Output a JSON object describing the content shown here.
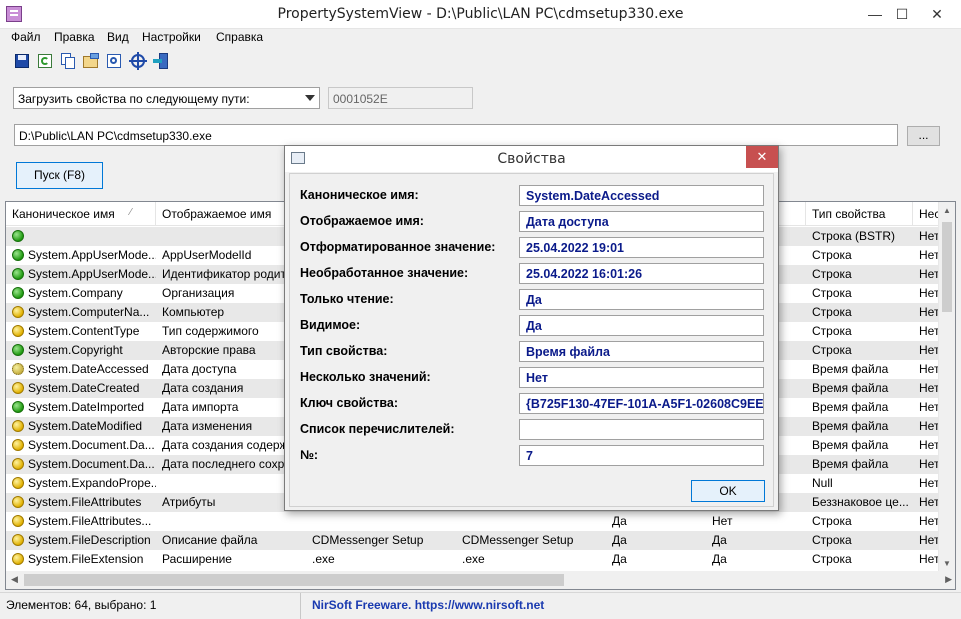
{
  "window": {
    "title": "PropertySystemView  -  D:\\Public\\LAN PC\\cdmsetup330.exe",
    "minimize": "—",
    "maximize": "☐",
    "close": "✕"
  },
  "menu": [
    "Файл",
    "Правка",
    "Вид",
    "Настройки",
    "Справка"
  ],
  "toolbar": {
    "icons": [
      "save-icon",
      "refresh-icon",
      "copy-icon",
      "properties-icon",
      "find-icon",
      "target-icon",
      "exit-icon"
    ]
  },
  "controls": {
    "load_mode": "Загрузить свойства по следующему пути:",
    "code_field": "0001052E",
    "path_field": "D:\\Public\\LAN PC\\cdmsetup330.exe",
    "browse_label": "...",
    "run_label": "Пуск (F8)"
  },
  "table": {
    "columns": [
      "Каноническое имя",
      "Отображаемое имя",
      "",
      "",
      "",
      "",
      "Тип свойства",
      "Нес"
    ],
    "rows": [
      {
        "status": "g",
        "c1": "",
        "c2": "",
        "c3": "",
        "c4": "",
        "c5": "",
        "c6": "",
        "type": "Строка (BSTR)",
        "c8": "Нет"
      },
      {
        "status": "g",
        "c1": "System.AppUserMode...",
        "c2": "AppUserModelId",
        "c3": "",
        "c4": "",
        "c5": "",
        "c6": "",
        "type": "Строка",
        "c8": "Нет"
      },
      {
        "status": "g",
        "c1": "System.AppUserMode...",
        "c2": "Идентификатор родит",
        "c3": "",
        "c4": "",
        "c5": "",
        "c6": "",
        "type": "Строка",
        "c8": "Нет"
      },
      {
        "status": "g",
        "c1": "System.Company",
        "c2": "Организация",
        "c3": "",
        "c4": "",
        "c5": "",
        "c6": "",
        "type": "Строка",
        "c8": "Нет"
      },
      {
        "status": "y",
        "c1": "System.ComputerNa...",
        "c2": "Компьютер",
        "c3": "",
        "c4": "",
        "c5": "",
        "c6": "",
        "type": "Строка",
        "c8": "Нет"
      },
      {
        "status": "y",
        "c1": "System.ContentType",
        "c2": "Тип содержимого",
        "c3": "",
        "c4": "",
        "c5": "",
        "c6": "",
        "type": "Строка",
        "c8": "Нет"
      },
      {
        "status": "g",
        "c1": "System.Copyright",
        "c2": "Авторские права",
        "c3": "",
        "c4": "",
        "c5": "",
        "c6": "",
        "type": "Строка",
        "c8": "Нет"
      },
      {
        "status": "gy",
        "c1": "System.DateAccessed",
        "c2": "Дата доступа",
        "c3": "",
        "c4": "",
        "c5": "",
        "c6": "",
        "type": "Время файла",
        "c8": "Нет"
      },
      {
        "status": "y",
        "c1": "System.DateCreated",
        "c2": "Дата создания",
        "c3": "",
        "c4": "",
        "c5": "",
        "c6": "",
        "type": "Время файла",
        "c8": "Нет"
      },
      {
        "status": "g",
        "c1": "System.DateImported",
        "c2": "Дата импорта",
        "c3": "",
        "c4": "",
        "c5": "",
        "c6": "",
        "type": "Время файла",
        "c8": "Нет"
      },
      {
        "status": "y",
        "c1": "System.DateModified",
        "c2": "Дата изменения",
        "c3": "",
        "c4": "",
        "c5": "",
        "c6": "",
        "type": "Время файла",
        "c8": "Нет"
      },
      {
        "status": "y",
        "c1": "System.Document.Da...",
        "c2": "Дата создания содерж",
        "c3": "",
        "c4": "",
        "c5": "",
        "c6": "",
        "type": "Время файла",
        "c8": "Нет"
      },
      {
        "status": "y",
        "c1": "System.Document.Da...",
        "c2": "Дата последнего сохра",
        "c3": "",
        "c4": "",
        "c5": "",
        "c6": "",
        "type": "Время файла",
        "c8": "Нет"
      },
      {
        "status": "y",
        "c1": "System.ExpandoPrope...",
        "c2": "",
        "c3": "",
        "c4": "",
        "c5": "",
        "c6": "",
        "type": "Null",
        "c8": "Нет"
      },
      {
        "status": "y",
        "c1": "System.FileAttributes",
        "c2": "Атрибуты",
        "c3": "",
        "c4": "",
        "c5": "",
        "c6": "",
        "type": "Беззнаковое це...",
        "c8": "Нет"
      },
      {
        "status": "y",
        "c1": "System.FileAttributes...",
        "c2": "",
        "c3": "",
        "c4": "",
        "c5": "Да",
        "c6": "Нет",
        "type": "Строка",
        "c8": "Нет"
      },
      {
        "status": "y",
        "c1": "System.FileDescription",
        "c2": "Описание файла",
        "c3": "CDMessenger Setup",
        "c4": "CDMessenger Setup",
        "c5": "Да",
        "c6": "Да",
        "type": "Строка",
        "c8": "Нет"
      },
      {
        "status": "y",
        "c1": "System.FileExtension",
        "c2": "Расширение",
        "c3": ".exe",
        "c4": ".exe",
        "c5": "Да",
        "c6": "Да",
        "type": "Строка",
        "c8": "Нет"
      }
    ]
  },
  "status": {
    "left": "Элементов: 64, выбрано: 1",
    "right": "NirSoft Freeware. https://www.nirsoft.net"
  },
  "dialog": {
    "title": "Свойства",
    "close": "✕",
    "ok_label": "OK",
    "fields": [
      {
        "label": "Каноническое имя:",
        "value": "System.DateAccessed"
      },
      {
        "label": "Отображаемое имя:",
        "value": "Дата доступа"
      },
      {
        "label": "Отформатированное значение:",
        "value": "25.04.2022 19:01"
      },
      {
        "label": "Необработанное значение:",
        "value": "25.04.2022 16:01:26"
      },
      {
        "label": "Только чтение:",
        "value": "Да"
      },
      {
        "label": "Видимое:",
        "value": "Да"
      },
      {
        "label": "Тип свойства:",
        "value": "Время файла"
      },
      {
        "label": "Несколько значений:",
        "value": "Нет"
      },
      {
        "label": "Ключ свойства:",
        "value": "{B725F130-47EF-101A-A5F1-02608C9EE"
      },
      {
        "label": "Список перечислителей:",
        "value": ""
      },
      {
        "label": "№:",
        "value": "7"
      }
    ]
  }
}
